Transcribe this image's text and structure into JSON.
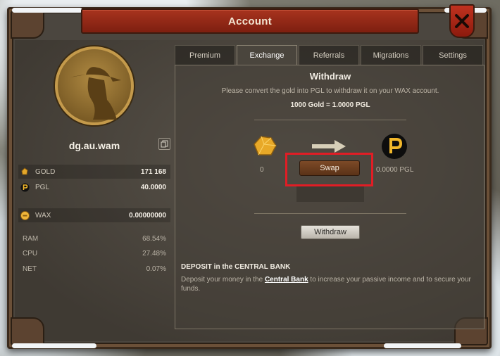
{
  "window": {
    "title": "Account"
  },
  "profile": {
    "username": "dg.au.wam"
  },
  "resources": [
    {
      "label": "GOLD",
      "value": "171 168",
      "icon": "gold-coin-icon"
    },
    {
      "label": "PGL",
      "value": "40.0000",
      "icon": "pgl-token-icon"
    },
    {
      "label": "WAX",
      "value": "0.00000000",
      "icon": "wax-coin-icon"
    }
  ],
  "stats": [
    {
      "label": "RAM",
      "value": "68.54%"
    },
    {
      "label": "CPU",
      "value": "27.48%"
    },
    {
      "label": "NET",
      "value": "0.07%"
    }
  ],
  "tabs": [
    {
      "label": "Premium",
      "active": false
    },
    {
      "label": "Exchange",
      "active": true
    },
    {
      "label": "Referrals",
      "active": false
    },
    {
      "label": "Migrations",
      "active": false
    },
    {
      "label": "Settings",
      "active": false
    }
  ],
  "withdraw": {
    "heading": "Withdraw",
    "note": "Please convert the gold into PGL to withdraw it on your WAX account.",
    "rate": "1000 Gold = 1.0000 PGL",
    "gold_amount": "0",
    "pgl_amount": "0.0000 PGL",
    "swap_label": "Swap",
    "withdraw_label": "Withdraw"
  },
  "deposit": {
    "title": "DEPOSIT in the CENTRAL BANK",
    "text_before": "Deposit your money in the ",
    "link": "Central Bank",
    "text_after": " to increase your passive income and to secure your funds."
  },
  "colors": {
    "title_bar": "#9a2a18",
    "swap_button": "#6b3c1f",
    "highlight": "#e11d25",
    "gold": "#e3a72a"
  }
}
